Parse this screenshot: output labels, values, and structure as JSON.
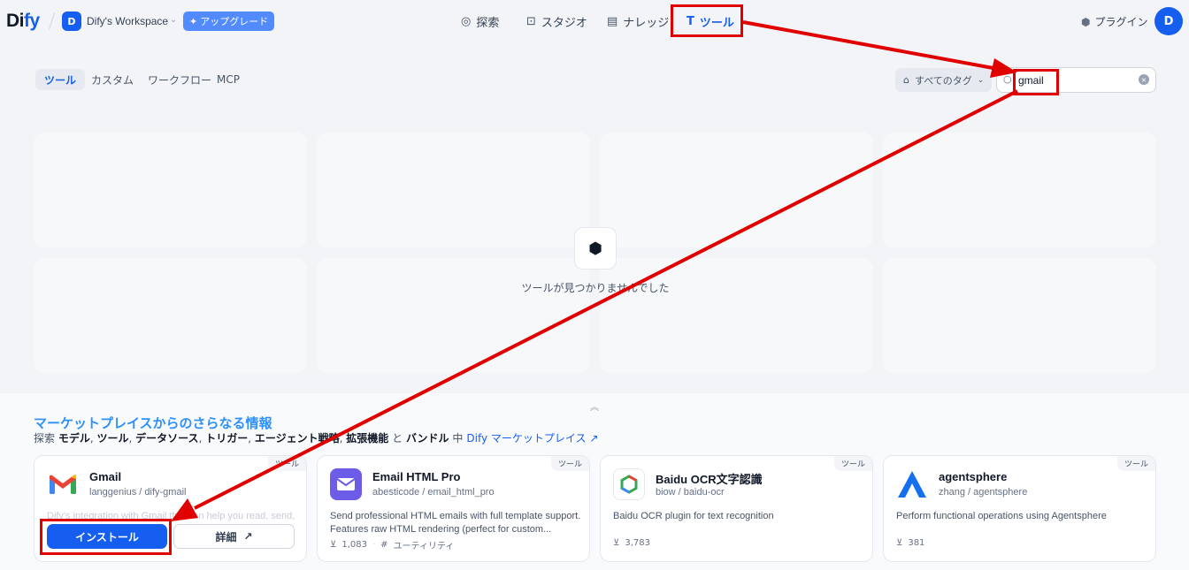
{
  "header": {
    "logo_text_a": "Di",
    "logo_text_b": "fy",
    "workspace_initial": "D",
    "workspace_name": "Dify's Workspace",
    "upgrade_label": "アップグレード",
    "nav": [
      {
        "label": "探索",
        "icon": "compass-icon"
      },
      {
        "label": "スタジオ",
        "icon": "robot-icon"
      },
      {
        "label": "ナレッジ",
        "icon": "book-icon"
      },
      {
        "label": "ツール",
        "icon": "tool-icon"
      }
    ],
    "plugins_label": "プラグイン",
    "user_initial": "D"
  },
  "tabs": [
    "ツール",
    "カスタム",
    "ワークフロー",
    "MCP"
  ],
  "tag_filter_label": "すべてのタグ",
  "search": {
    "value": "gmail"
  },
  "empty_state_text": "ツールが見つかりませんでした",
  "marketplace": {
    "title": "マーケットプレイスからのさらなる情報",
    "subtitle_prefix": "探索",
    "subtitle_items": [
      "モデル",
      "ツール",
      "データソース",
      "トリガー",
      "エージェント戦略",
      "拡張機能"
    ],
    "subtitle_and": "と",
    "subtitle_last": "バンドル",
    "subtitle_in": "中",
    "link_label": "Dify マーケットプレイス",
    "cards": [
      {
        "name": "Gmail",
        "org": "langgenius",
        "pkg": "dify-gmail",
        "badge": "ツール",
        "desc": "Dify's integration with Gmail that can help you read, send,",
        "installs": "",
        "tag": ""
      },
      {
        "name": "Email HTML Pro",
        "org": "abesticode",
        "pkg": "email_html_pro",
        "badge": "ツール",
        "desc": "Send professional HTML emails with full template support. Features raw HTML rendering (perfect for custom...",
        "installs": "1,083",
        "tag": "ユーティリティ"
      },
      {
        "name": "Baidu OCR文字認識",
        "org": "biow",
        "pkg": "baidu-ocr",
        "badge": "ツール",
        "desc": "Baidu OCR plugin for text recognition",
        "installs": "3,783",
        "tag": ""
      },
      {
        "name": "agentsphere",
        "org": "zhang",
        "pkg": "agentsphere",
        "badge": "ツール",
        "desc": "Perform functional operations using Agentsphere",
        "installs": "381",
        "tag": ""
      }
    ],
    "install_label": "インストール",
    "detail_label": "詳細"
  },
  "colors": {
    "accent": "#155eef",
    "annotation": "#e00000",
    "market_title": "#2e90fa"
  }
}
